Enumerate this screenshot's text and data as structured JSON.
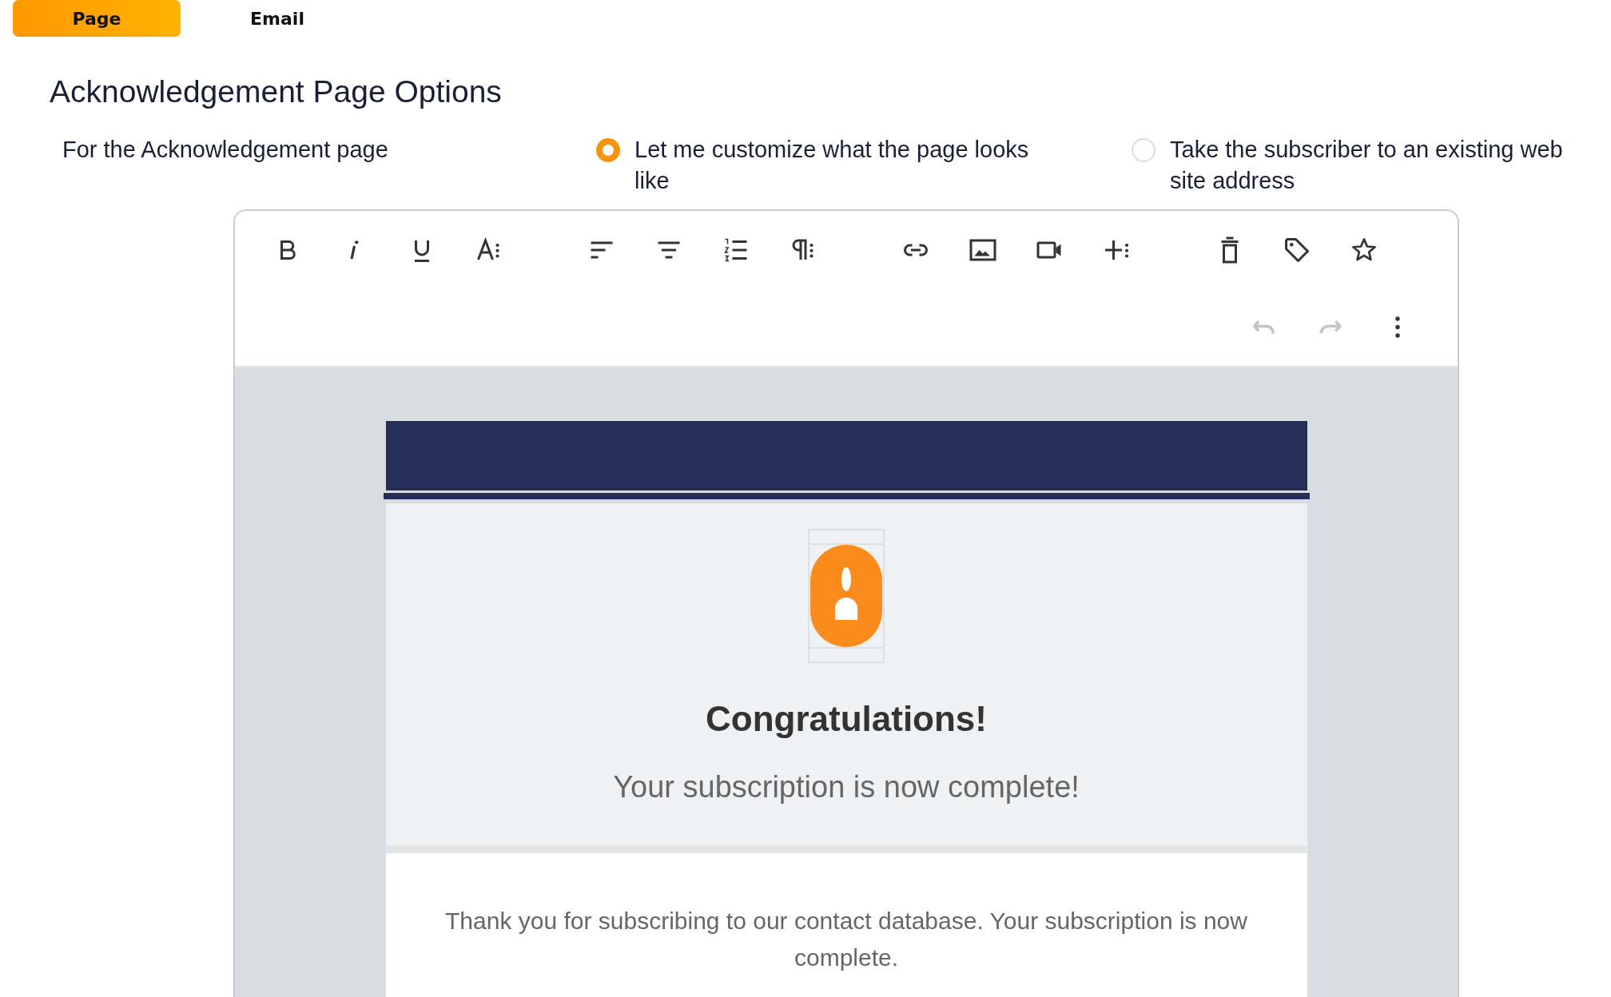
{
  "tabs": [
    {
      "label": "Page",
      "selected": true
    },
    {
      "label": "Email",
      "selected": false
    }
  ],
  "heading": "Acknowledgement Page Options",
  "options": {
    "label": "For the Acknowledgement page",
    "choices": [
      {
        "label": "Let me customize what the page looks like",
        "selected": true
      },
      {
        "label": "Take the subscriber to an existing web site address",
        "selected": false
      }
    ]
  },
  "editor": {
    "history": [
      {
        "kind": "undo",
        "disabled": true
      },
      {
        "kind": "redo",
        "disabled": true
      }
    ],
    "preview": {
      "title": "Congratulations!",
      "subtitle": "Your subscription is now complete!",
      "body": "Thank you for subscribing to our contact database. Your subscription is now complete."
    }
  }
}
